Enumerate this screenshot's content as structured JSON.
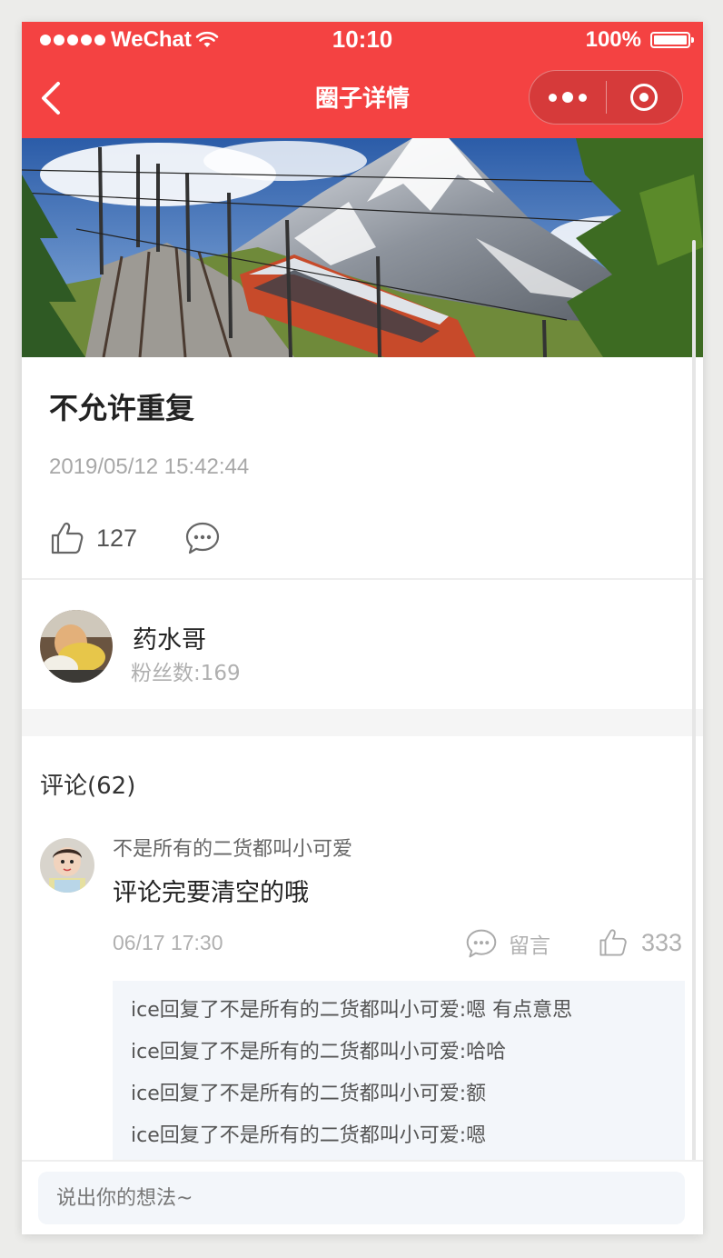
{
  "status_bar": {
    "carrier": "WeChat",
    "time": "10:10",
    "battery_percent": "100%",
    "battery_level": 1.0,
    "signal_icon": "signal-dots-icon",
    "wifi_icon": "wifi-icon"
  },
  "nav": {
    "title": "圈子详情",
    "back_icon": "chevron-left-icon",
    "more_icon": "more-dots-icon",
    "close_icon": "target-circle-icon"
  },
  "hero": {
    "icon": "mountain-train-photo"
  },
  "post": {
    "title": "不允许重复",
    "time": "2019/05/12 15:42:44",
    "like_count": "127",
    "like_icon": "thumbs-up-icon",
    "comment_icon": "chat-bubble-icon"
  },
  "author": {
    "name": "药水哥",
    "fans": "粉丝数:169"
  },
  "comments": {
    "header": "评论(62)",
    "items": [
      {
        "name": "不是所有的二货都叫小可爱",
        "text": "评论完要清空的哦",
        "time": "06/17 17:30",
        "reply_label": "留言",
        "like_count": "333",
        "replies": [
          "ice回复了不是所有的二货都叫小可爱:嗯 有点意思",
          "ice回复了不是所有的二货都叫小可爱:哈哈",
          "ice回复了不是所有的二货都叫小可爱:额",
          "ice回复了不是所有的二货都叫小可爱:嗯"
        ]
      }
    ]
  },
  "input": {
    "placeholder": "说出你的想法~"
  },
  "colors": {
    "brand": "#f44242",
    "reply_bg": "#f3f6fa",
    "muted_text": "#b0b0b0"
  }
}
